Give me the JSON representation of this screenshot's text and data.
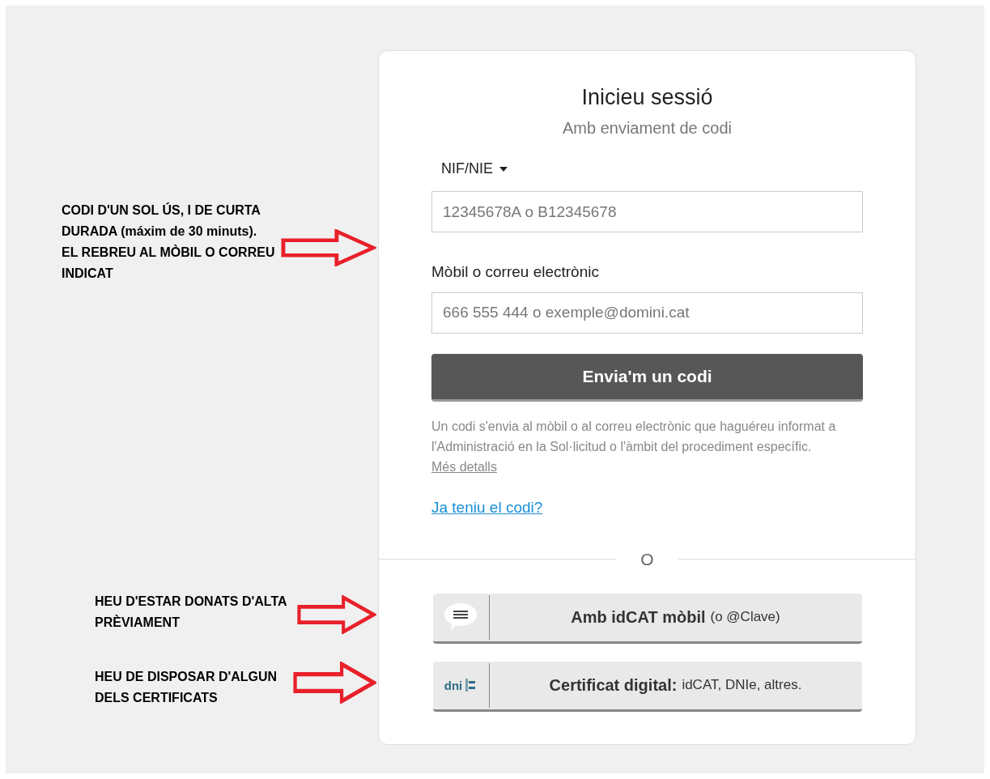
{
  "annotations": [
    {
      "text": "CODI D'UN SOL ÚS, I DE CURTA DURADA (máxim de 30 minuts). EL REBREU AL MÒBIL O CORREU INDICAT"
    },
    {
      "text": "HEU D'ESTAR DONATS D'ALTA PRÈVIAMENT"
    },
    {
      "text": "HEU DE DISPOSAR D'ALGUN DELS CERTIFICATS"
    }
  ],
  "login": {
    "title": "Inicieu sessió",
    "subtitle": "Amb enviament de codi",
    "id_type": {
      "label": "NIF/NIE"
    },
    "id_field": {
      "placeholder": "12345678A o B12345678"
    },
    "contact_label": "Mòbil o correu electrònic",
    "contact_field": {
      "placeholder": "666 555 444 o exemple@domini.cat"
    },
    "send_button": "Envia'm un codi",
    "help_text": "Un codi s'envia al mòbil o al correu electrònic que haguéreu informat a l'Administració en la Sol·licitud o l'àmbit del procediment específic.",
    "help_link": "Més detalls",
    "code_link": "Ja teniu el codi?",
    "separator": "O",
    "alt_buttons": [
      {
        "kind": "mobile",
        "label": "Amb idCAT mòbil",
        "note": "(o @Clave)"
      },
      {
        "kind": "certificate",
        "logo_text": "dni",
        "label": "Certificat digital:",
        "note": "idCAT, DNIe, altres."
      }
    ]
  }
}
